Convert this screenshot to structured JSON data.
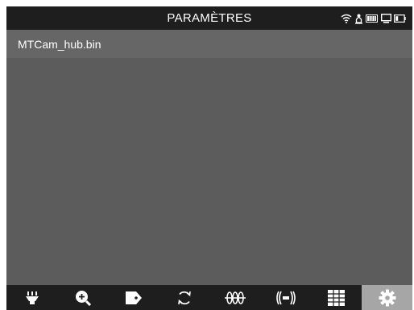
{
  "header": {
    "title": "PARAMÈTRES",
    "status_icons": [
      "wifi-icon",
      "location-icon",
      "battery-full-icon",
      "screen-icon",
      "battery-low-icon"
    ]
  },
  "content": {
    "file_name": "MTCam_hub.bin"
  },
  "toolbar": {
    "active_tool": "settings",
    "tools": [
      "flashlight-icon",
      "zoom-in-icon",
      "tag-icon",
      "rotate-icon",
      "filter-icon",
      "vibration-icon",
      "grid-icon",
      "gear-icon"
    ]
  },
  "colors": {
    "header_bg": "#1e1e1e",
    "content_bg": "#5c5c5c",
    "file_row_bg": "#666666",
    "active_tab_bg": "#a6a6a6",
    "text": "#ffffff"
  }
}
